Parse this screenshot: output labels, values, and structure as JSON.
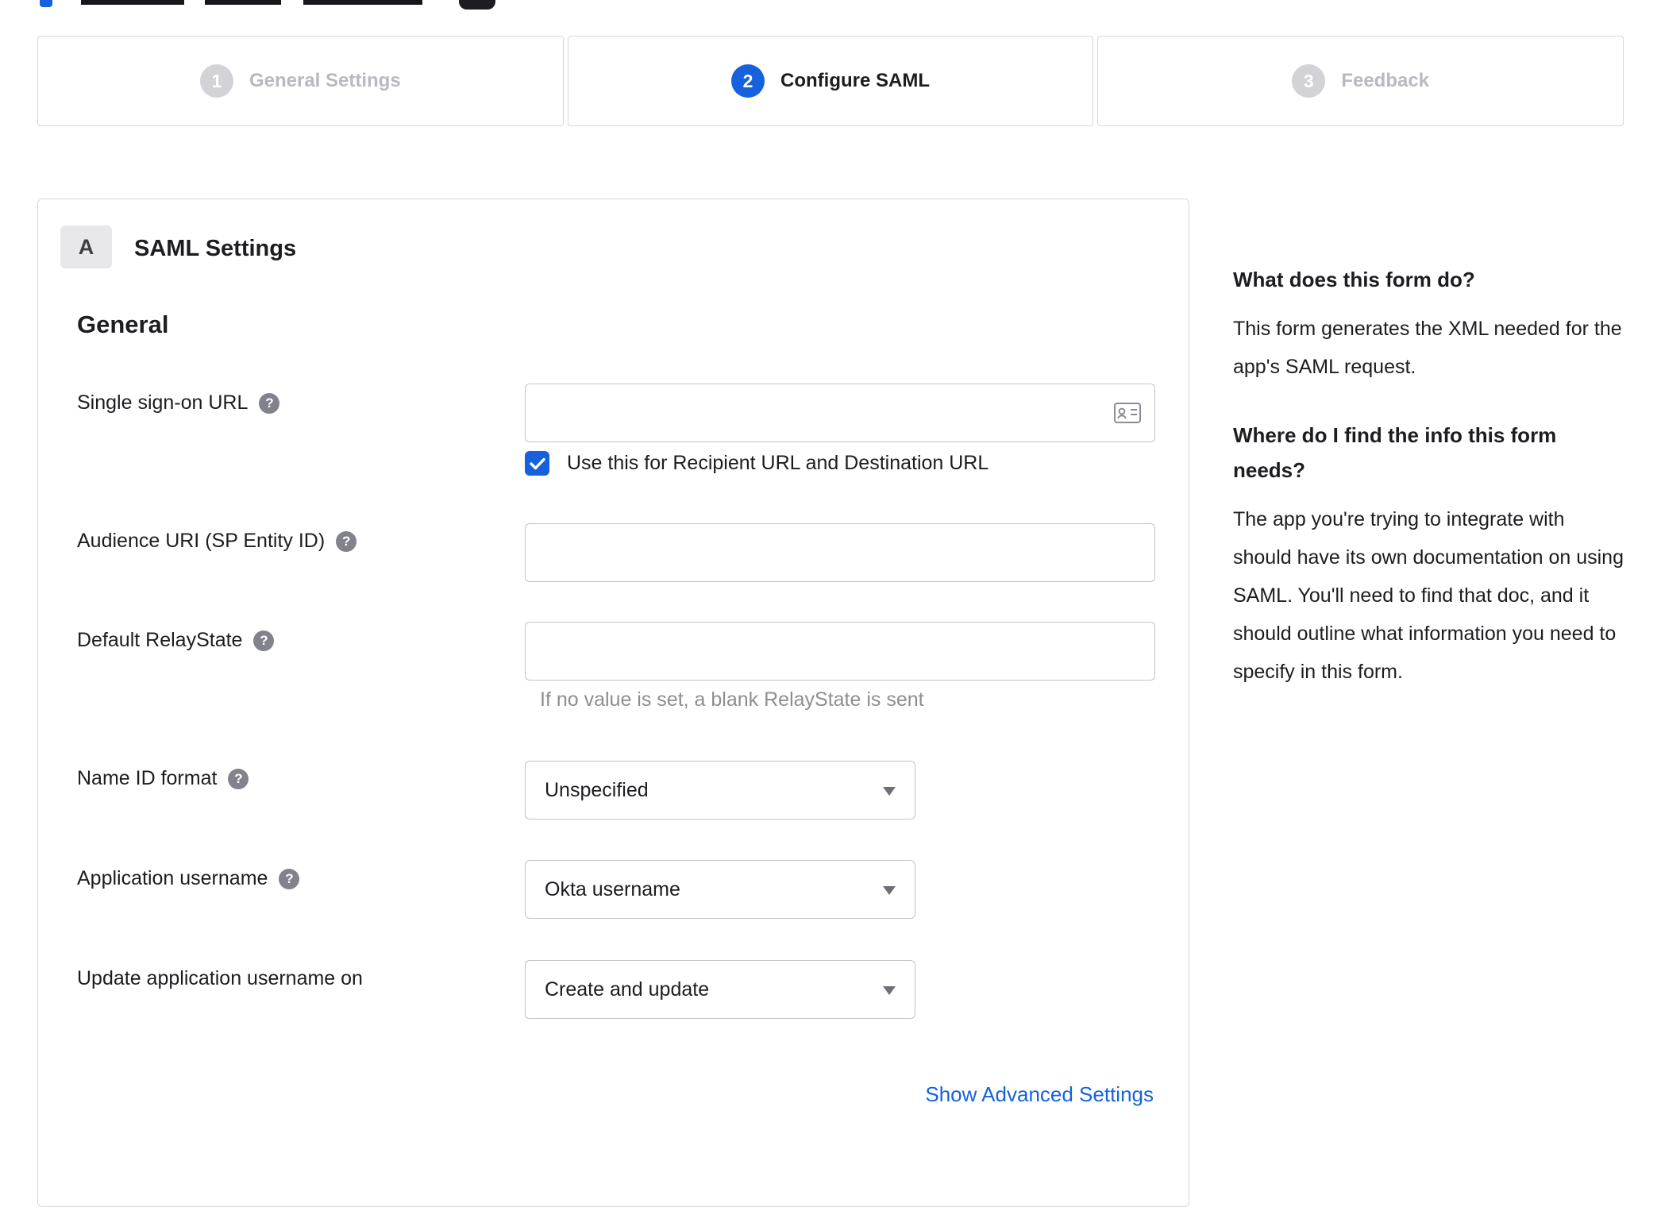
{
  "accent_color": "#1662dd",
  "icons": {
    "help": "?"
  },
  "stepper": {
    "steps": [
      {
        "number": "1",
        "label": "General Settings"
      },
      {
        "number": "2",
        "label": "Configure SAML"
      },
      {
        "number": "3",
        "label": "Feedback"
      }
    ],
    "active_step": "2"
  },
  "panel": {
    "section_badge": "A",
    "section_title": "SAML Settings",
    "group_title": "General",
    "fields": {
      "sso_url": {
        "label": "Single sign-on URL",
        "value": "",
        "checkbox_label": "Use this for Recipient URL and Destination URL",
        "checkbox_checked": true
      },
      "audience_uri": {
        "label": "Audience URI (SP Entity ID)",
        "value": ""
      },
      "default_relaystate": {
        "label": "Default RelayState",
        "value": "",
        "helper": "If no value is set, a blank RelayState is sent"
      },
      "name_id_format": {
        "label": "Name ID format",
        "value": "Unspecified"
      },
      "application_username": {
        "label": "Application username",
        "value": "Okta username"
      },
      "update_app_username": {
        "label": "Update application username on",
        "value": "Create and update"
      }
    },
    "advanced_link": "Show Advanced Settings"
  },
  "sidebar": {
    "blocks": [
      {
        "heading": "What does this form do?",
        "body": "This form generates the XML needed for the app's SAML request."
      },
      {
        "heading": "Where do I find the info this form needs?",
        "body": "The app you're trying to integrate with should have its own documentation on using SAML. You'll need to find that doc, and it should outline what information you need to specify in this form."
      }
    ]
  }
}
